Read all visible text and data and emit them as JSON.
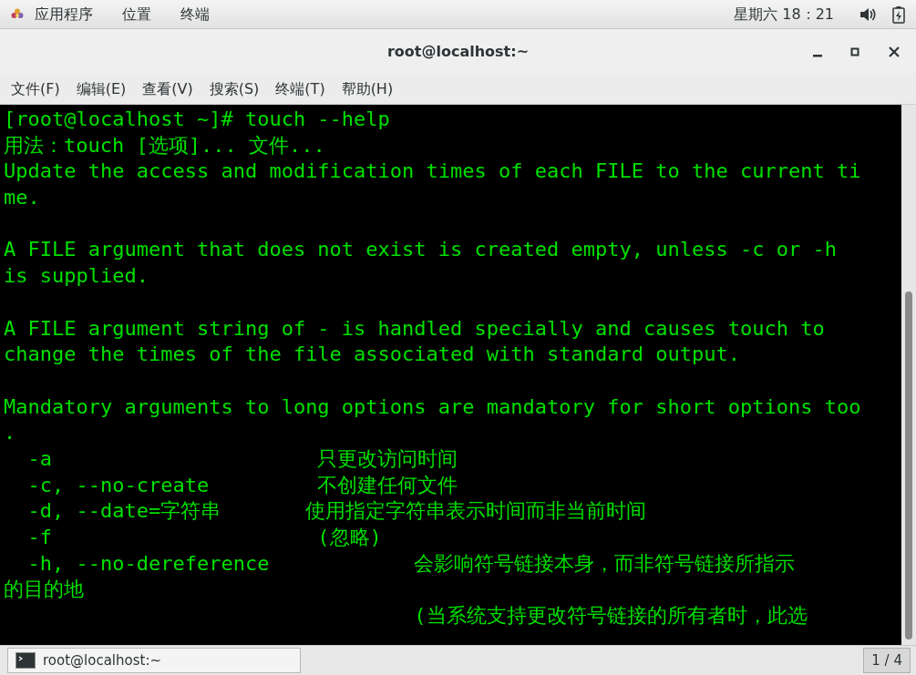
{
  "top_bar": {
    "menus": [
      "应用程序",
      "位置",
      "终端"
    ],
    "clock": "星期六 18：21"
  },
  "window": {
    "title": "root@localhost:~"
  },
  "menu_bar": [
    "文件(F)",
    "编辑(E)",
    "查看(V)",
    "搜索(S)",
    "终端(T)",
    "帮助(H)"
  ],
  "terminal": {
    "lines": [
      {
        "kind": "text",
        "text": "[root@localhost ~]# touch --help"
      },
      {
        "kind": "text",
        "text": "用法：touch [选项]... 文件..."
      },
      {
        "kind": "text",
        "text": "Update the access and modification times of each FILE to the current ti"
      },
      {
        "kind": "text",
        "text": "me."
      },
      {
        "kind": "blank"
      },
      {
        "kind": "text",
        "text": "A FILE argument that does not exist is created empty, unless -c or -h"
      },
      {
        "kind": "text",
        "text": "is supplied."
      },
      {
        "kind": "blank"
      },
      {
        "kind": "text",
        "text": "A FILE argument string of - is handled specially and causes touch to"
      },
      {
        "kind": "text",
        "text": "change the times of the file associated with standard output."
      },
      {
        "kind": "blank"
      },
      {
        "kind": "text",
        "text": "Mandatory arguments to long options are mandatory for short options too"
      },
      {
        "kind": "text",
        "text": "."
      },
      {
        "kind": "text",
        "text": "  -a                      只更改访问时间"
      },
      {
        "kind": "text",
        "text": "  -c, --no-create         不创建任何文件"
      },
      {
        "kind": "text",
        "text": "  -d, --date=字符串       使用指定字符串表示时间而非当前时间"
      },
      {
        "kind": "text",
        "text": "  -f                      (忽略)"
      },
      {
        "kind": "text",
        "text": "  -h, --no-dereference            会影响符号链接本身，而非符号链接所指示"
      },
      {
        "kind": "text",
        "text": "的目的地"
      },
      {
        "kind": "text",
        "text": "                                  (当系统支持更改符号链接的所有者时，此选"
      }
    ]
  },
  "taskbar": {
    "window_button": "root@localhost:~",
    "workspace": "1 / 4"
  }
}
